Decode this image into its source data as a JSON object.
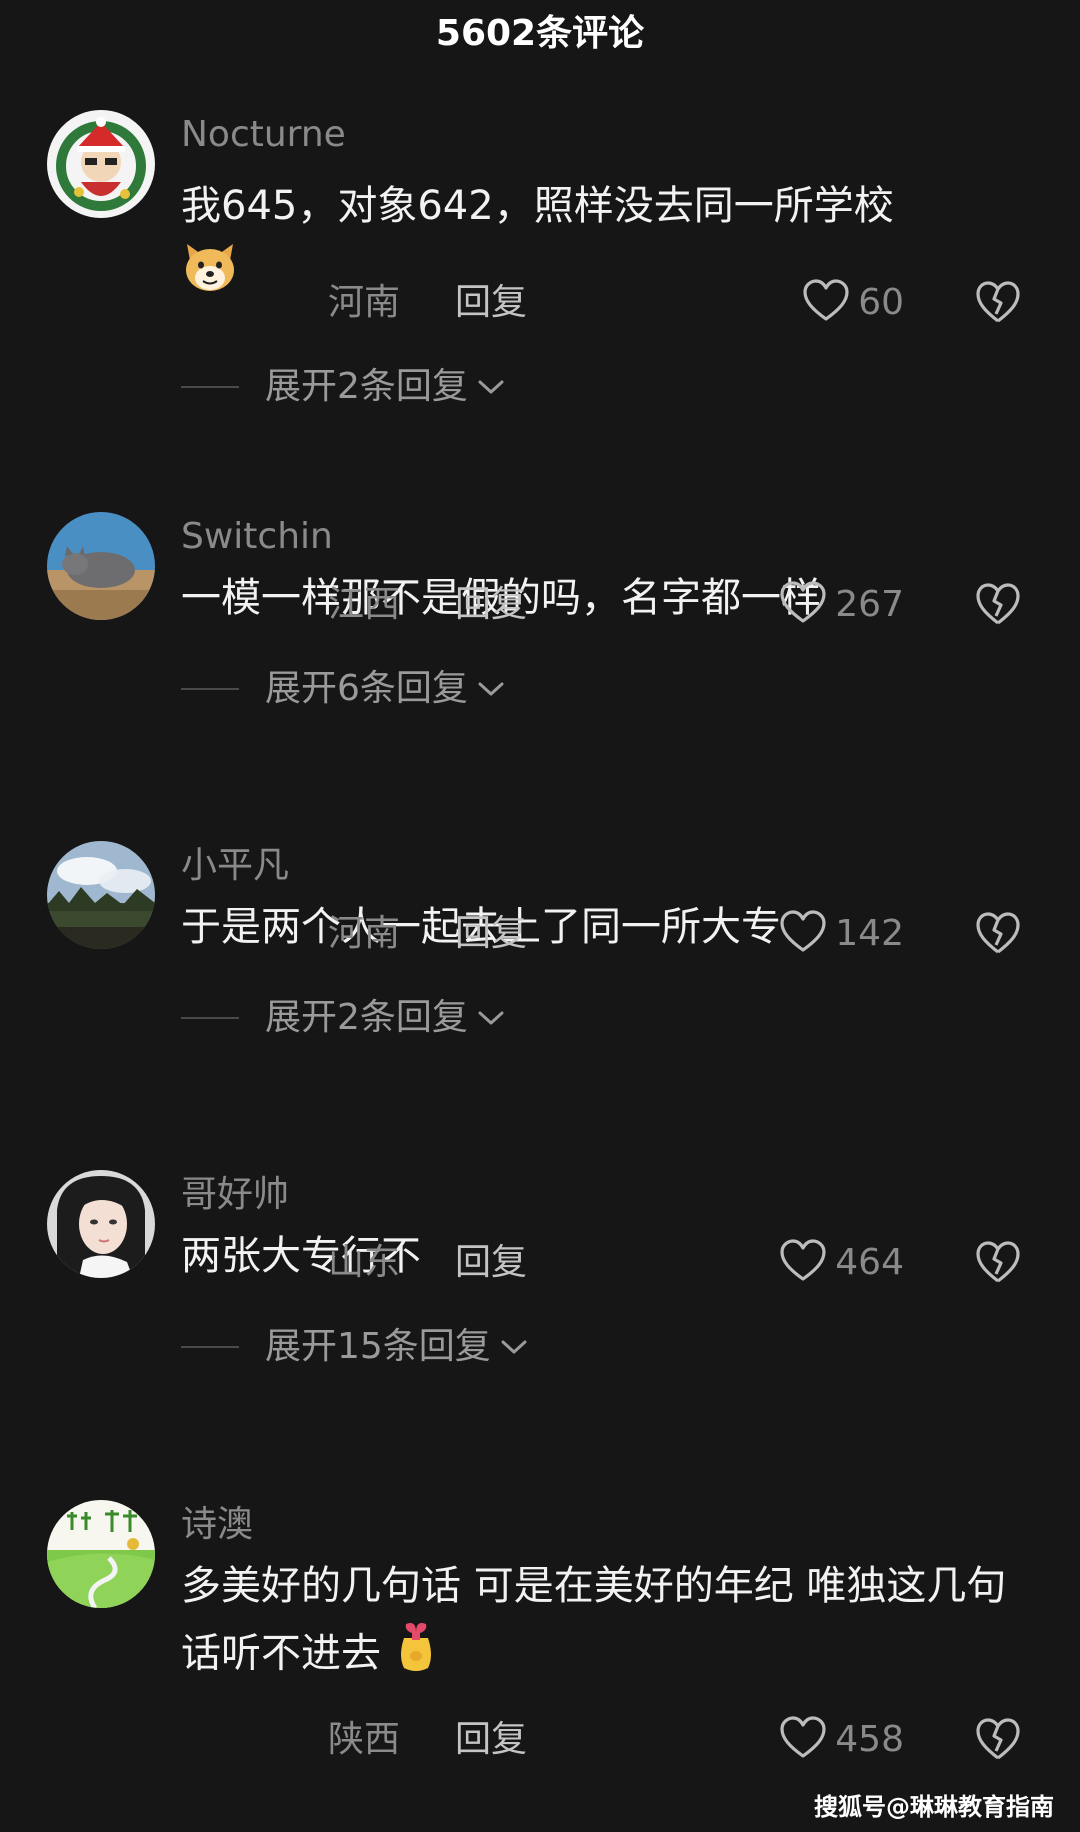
{
  "header": {
    "title": "5602条评论"
  },
  "comments": [
    {
      "username": "Nocturne",
      "text": "我645，对象642，照样没去同一所学校",
      "emoji": "dog-face-emoji",
      "location": "河南",
      "reply_label": "回复",
      "likes": "60",
      "expand_label": "展开2条回复"
    },
    {
      "username": "Switchin",
      "text": "一模一样那不是假的吗，名字都一样",
      "location": "江西",
      "reply_label": "回复",
      "likes": "267",
      "expand_label": "展开6条回复"
    },
    {
      "username": "小平凡",
      "text": "于是两个人一起去上了同一所大专",
      "location": "河南",
      "reply_label": "回复",
      "likes": "142",
      "expand_label": "展开2条回复"
    },
    {
      "username": "哥好帅",
      "text": "两张大专行不",
      "location": "山东",
      "reply_label": "回复",
      "likes": "464",
      "expand_label": "展开15条回复"
    },
    {
      "username": "诗澳",
      "text": "多美好的几句话 可是在美好的年纪 唯独这几句话听不进去",
      "emoji": "gift-bag-emoji",
      "location": "陕西",
      "reply_label": "回复",
      "likes": "458"
    }
  ],
  "watermark": "搜狐号@琳琳教育指南",
  "colors": {
    "background": "#161616",
    "text": "#f2f2f2",
    "muted": "#8a8a8a"
  }
}
